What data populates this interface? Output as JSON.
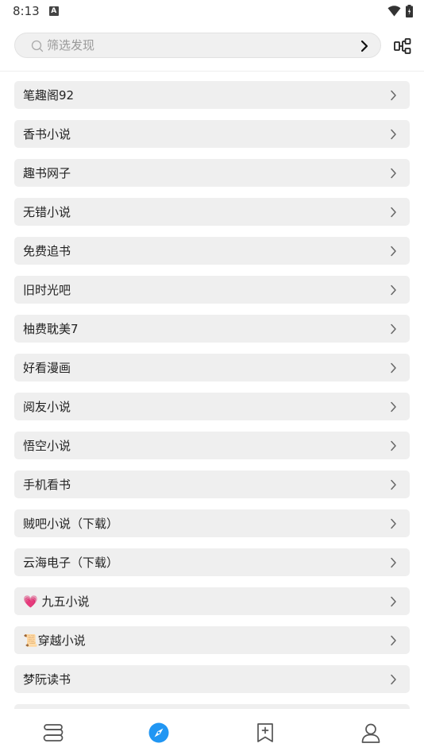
{
  "status_bar": {
    "time": "8:13",
    "notification_icon_letter": "A"
  },
  "search": {
    "placeholder": "筛选发现",
    "value": ""
  },
  "discover_items": [
    {
      "label": "笔趣阁92"
    },
    {
      "label": "香书小说"
    },
    {
      "label": "趣书网子"
    },
    {
      "label": "无错小说"
    },
    {
      "label": "免费追书"
    },
    {
      "label": "旧时光吧"
    },
    {
      "label": "柚费耽美7"
    },
    {
      "label": "好看漫画"
    },
    {
      "label": "阅友小说"
    },
    {
      "label": "悟空小说"
    },
    {
      "label": "手机看书"
    },
    {
      "label": "贼吧小说（下载）"
    },
    {
      "label": "云海电子（下载）"
    },
    {
      "label": "💗 九五小说"
    },
    {
      "label": "📜穿越小说"
    },
    {
      "label": "梦阮读书"
    },
    {
      "label": ""
    }
  ],
  "bottom_nav": [
    {
      "icon": "bookshelf-icon",
      "active": false
    },
    {
      "icon": "compass-icon",
      "active": true
    },
    {
      "icon": "bookmark-add-icon",
      "active": false
    },
    {
      "icon": "profile-icon",
      "active": false
    }
  ],
  "colors": {
    "accent": "#2196F3",
    "item_background": "#efefef",
    "icon_gray": "#555555"
  }
}
